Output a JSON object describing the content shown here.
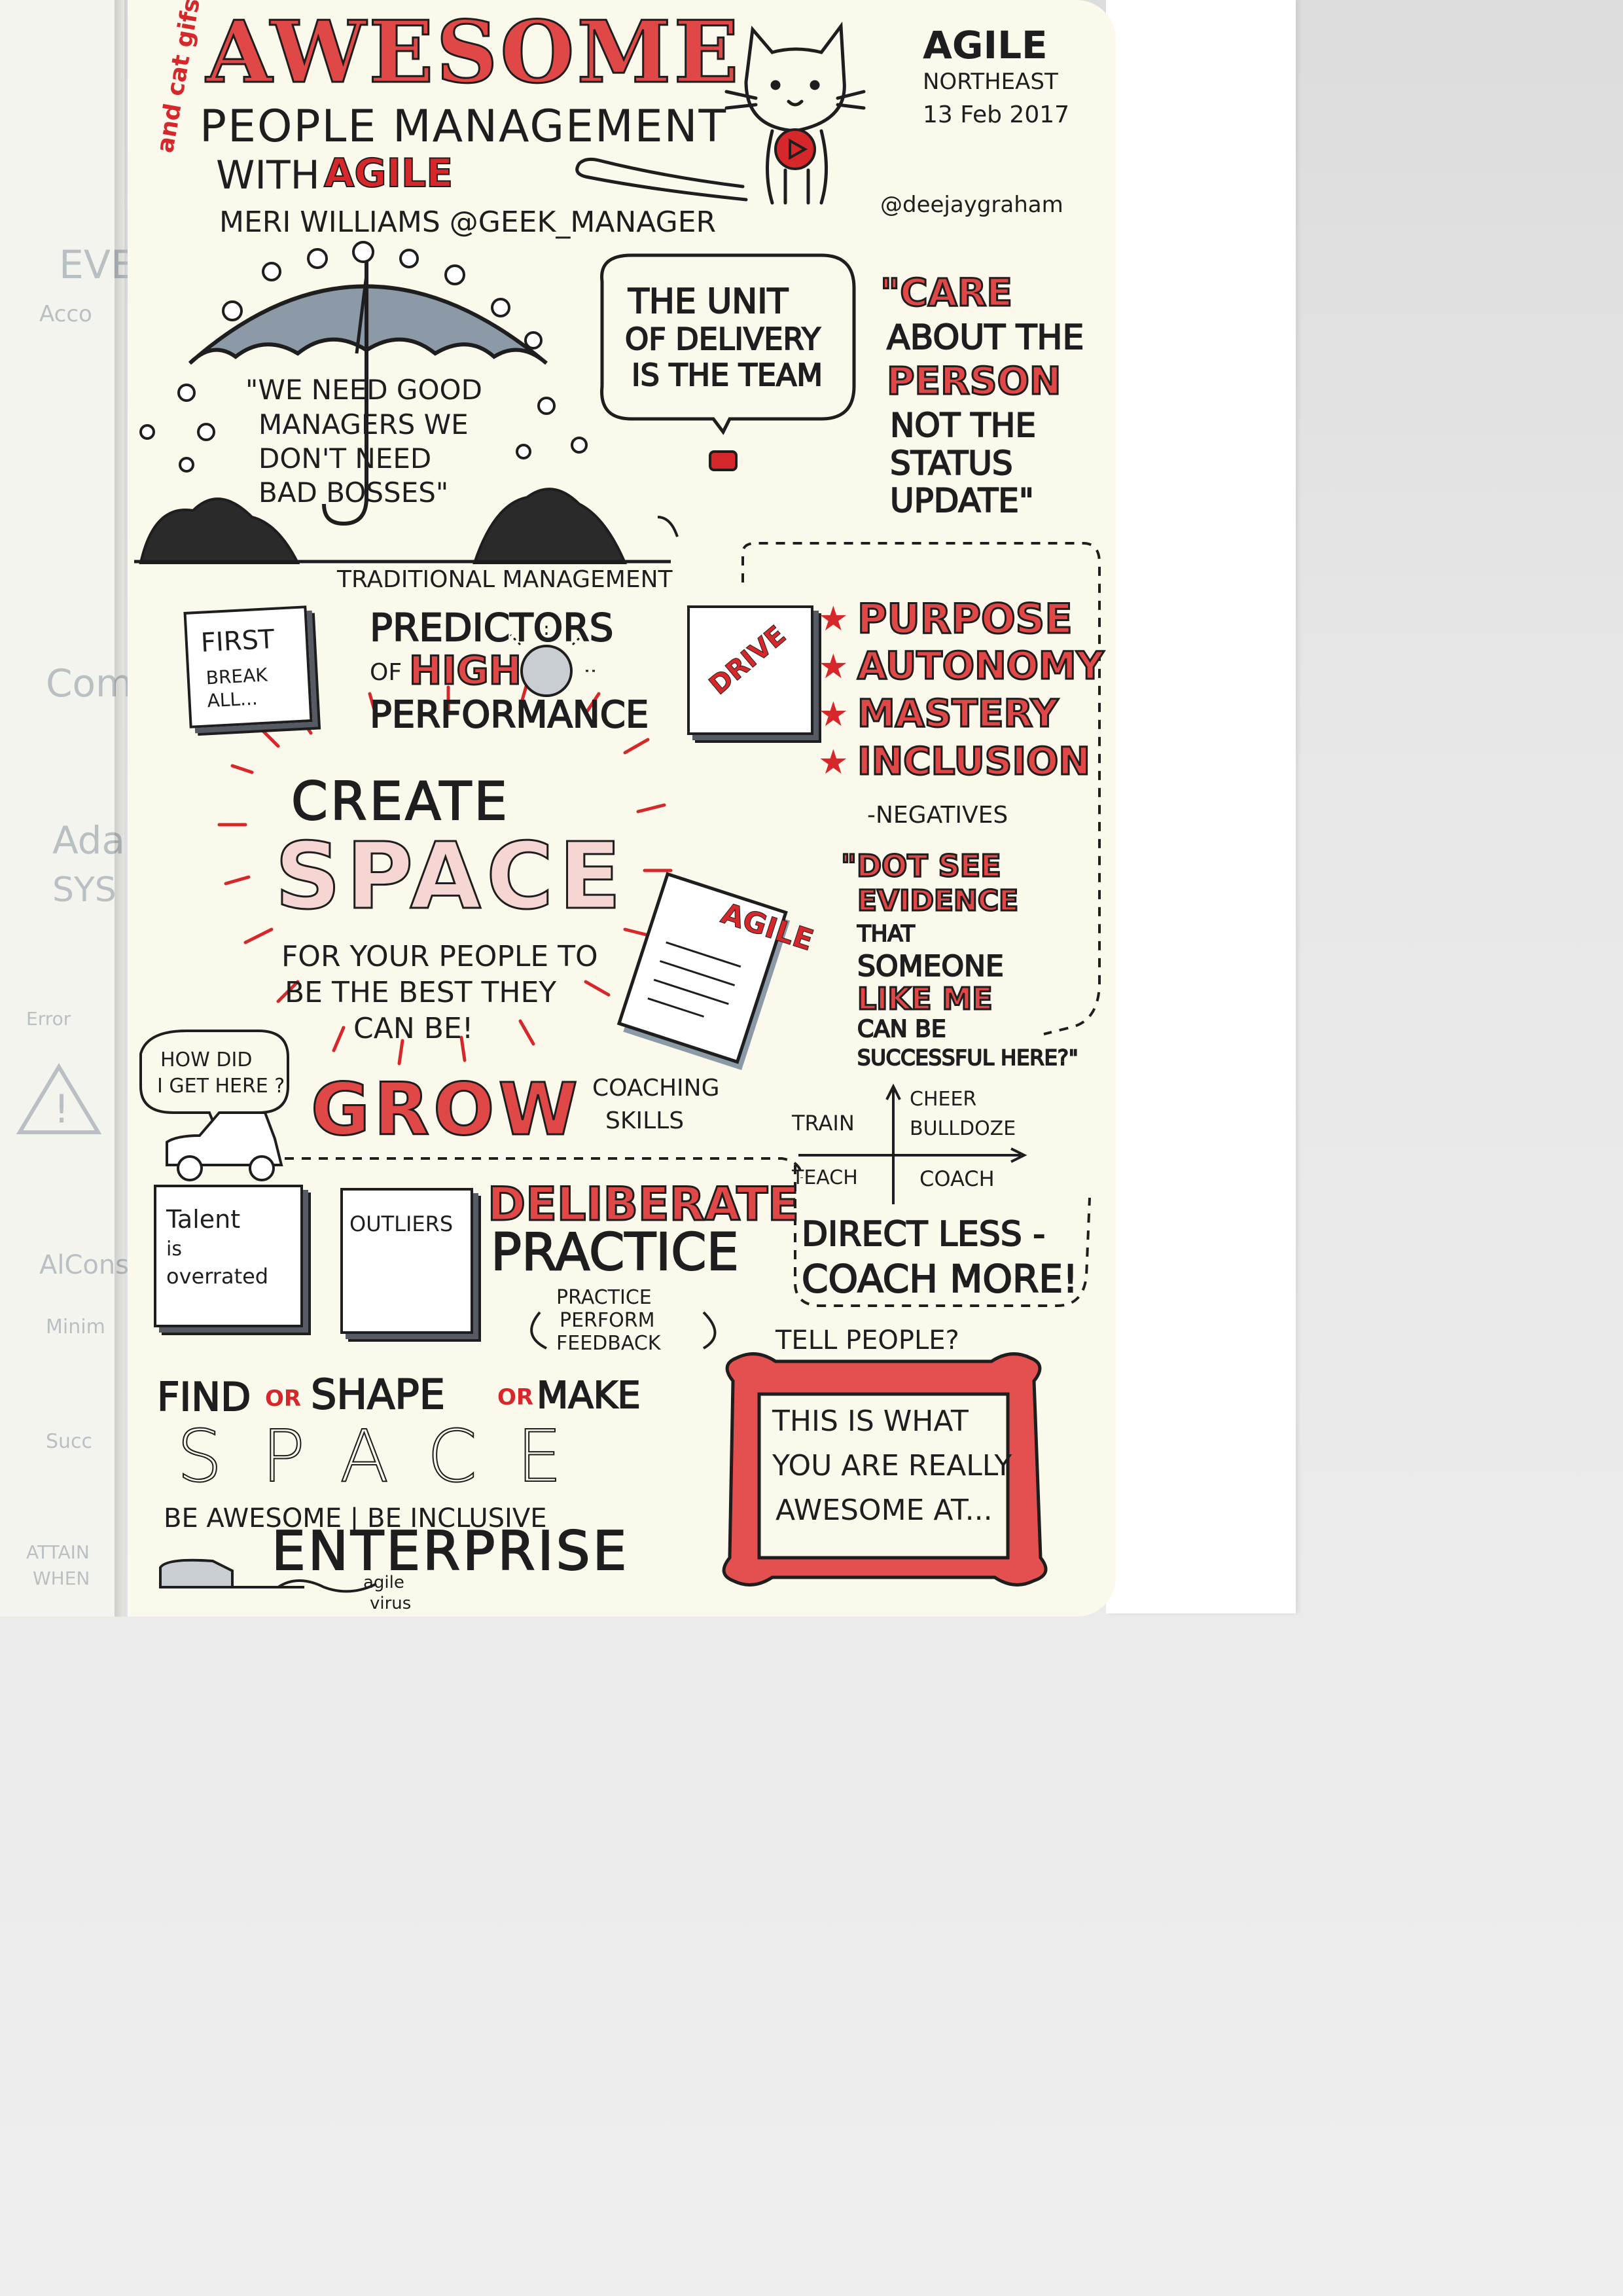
{
  "left_page": {
    "fragments": [
      "EVE",
      "Acco",
      "Com",
      "Ada",
      "SYS",
      "Error",
      "AlCons",
      "Minim",
      "Succ",
      "ATTAIN",
      "WHEN"
    ]
  },
  "header": {
    "title": "AWESOME",
    "aside": "and cat gifs",
    "subtitle_line1": "PEOPLE MANAGEMENT",
    "subtitle_line2_prefix": "WITH",
    "subtitle_line2_emphasis": "AGILE",
    "speaker": "MERI WILLIAMS @GEEK_MANAGER",
    "event_name": "AGILE",
    "event_sub": "NORTHEAST",
    "event_date": "13 Feb 2017",
    "artist": "@deejaygraham"
  },
  "umbrella": {
    "quote": "\"WE NEED GOOD MANAGERS WE DON'T NEED BAD BOSSES\"",
    "quote_lines": [
      "\"WE NEED GOOD",
      "MANAGERS WE",
      "DON'T NEED",
      "BAD BOSSES\""
    ],
    "caption": "TRADITIONAL MANAGEMENT"
  },
  "speech_bubble": {
    "lines": [
      "THE UNIT",
      "OF DELIVERY",
      "IS THE TEAM"
    ]
  },
  "care_quote": {
    "lines": [
      "\"CARE",
      "ABOUT THE",
      "PERSON",
      "NOT THE",
      "STATUS",
      "UPDATE\""
    ]
  },
  "books_row": {
    "first_book": [
      "FIRST",
      "BREAK",
      "ALL..."
    ],
    "predictors": [
      "PREDICTORS",
      "OF",
      "HIGH",
      "PERFORMANCE"
    ],
    "drive_book": "DRIVE"
  },
  "motivators": {
    "items": [
      "PURPOSE",
      "AUTONOMY",
      "MASTERY",
      "INCLUSION"
    ],
    "star": "★",
    "negatives": "-NEGATIVES",
    "quote_lines": [
      "\"DOT SEE",
      "EVIDENCE",
      "THAT",
      "SOMEONE",
      "LIKE ME",
      "CAN BE",
      "SUCCESSFUL HERE?\""
    ]
  },
  "create_space": {
    "create": "CREATE",
    "space": "SPACE",
    "lines": [
      "FOR YOUR PEOPLE TO",
      "BE THE BEST THEY",
      "CAN BE!"
    ]
  },
  "agile_paper": "AGILE",
  "grow": {
    "thought": [
      "HOW DID",
      "I GET HERE ?"
    ],
    "word": "GROW",
    "coaching": [
      "COACHING",
      "SKILLS"
    ],
    "quadrant": {
      "top_left": "TRAIN",
      "top_right_1": "CHEER",
      "top_right_2": "BULLDOZE",
      "bottom_left": "TEACH",
      "bottom_right": "COACH"
    },
    "direct_less": [
      "DIRECT LESS -",
      "COACH MORE!"
    ]
  },
  "practice": {
    "book1": [
      "Talent",
      "is",
      "overrated"
    ],
    "book2": "OUTLIERS",
    "title": [
      "DELIBERATE",
      "PRACTICE"
    ],
    "cycle": [
      "PRACTICE",
      "PERFORM",
      "FEEDBACK"
    ]
  },
  "find_space": {
    "find": "FIND",
    "or1": "OR",
    "shape": "SHAPE",
    "or2": "OR",
    "make": "MAKE",
    "space": "SPACE",
    "be_awesome": "BE AWESOME | BE INCLUSIVE",
    "enterprise": "ENTERPRISE",
    "agile_virus": [
      "agile",
      "virus"
    ]
  },
  "tell_people": {
    "label": "TELL PEOPLE?",
    "frame_lines": [
      "THIS IS WHAT",
      "YOU ARE REALLY",
      "AWESOME AT..."
    ]
  },
  "colors": {
    "ink": "#1e1e1e",
    "red": "#d6282a",
    "paper": "#fbf8ec",
    "shadow_grey": "#555a63"
  }
}
